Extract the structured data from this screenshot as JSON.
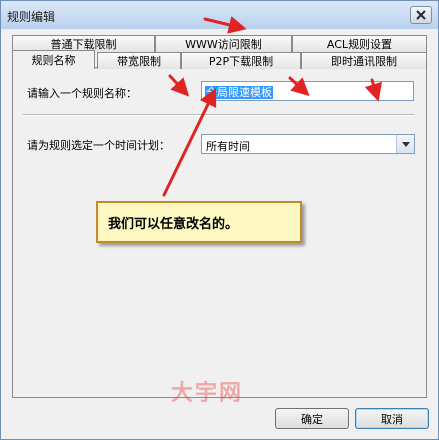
{
  "window": {
    "title": "规则编辑"
  },
  "tabs": {
    "row_back": [
      "普通下载限制",
      "WWW访问限制",
      "ACL规则设置"
    ],
    "row_front": [
      "规则名称",
      "带宽限制",
      "P2P下载限制",
      "即时通讯限制"
    ],
    "active": "规则名称"
  },
  "form": {
    "name_label": "请输入一个规则名称：",
    "name_value": "全局限速模板",
    "schedule_label": "请为规则选定一个时间计划：",
    "schedule_value": "所有时间"
  },
  "annotation": {
    "callout_text": "我们可以任意改名的。",
    "watermark": "大宇网"
  },
  "buttons": {
    "ok": "确定",
    "cancel": "取消"
  },
  "colors": {
    "arrow": "#e02424",
    "callout_bg": "#fdf7c2",
    "callout_border": "#c28a2a"
  }
}
